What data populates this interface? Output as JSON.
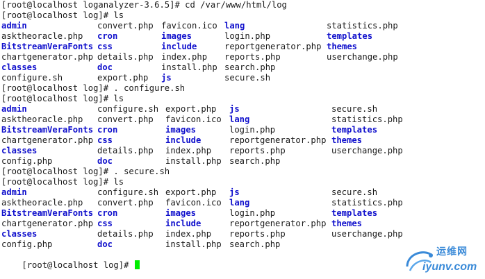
{
  "terminal": {
    "lines": {
      "l1": "[root@localhost loganalyzer-3.6.5]# cd /var/www/html/log",
      "l2": "[root@localhost log]# ls",
      "l9": "[root@localhost log]# . configure.sh",
      "l10": "[root@localhost log]# ls",
      "l17": "[root@localhost log]# . secure.sh",
      "l18": "[root@localhost log]# ls",
      "l25": "[root@localhost log]# "
    },
    "ls1": [
      [
        "admin",
        "convert.php",
        "favicon.ico",
        "lang",
        "statistics.php"
      ],
      [
        "asktheoracle.php",
        "cron",
        "images",
        "login.php",
        "templates"
      ],
      [
        "BitstreamVeraFonts",
        "css",
        "include",
        "reportgenerator.php",
        "themes"
      ],
      [
        "chartgenerator.php",
        "details.php",
        "index.php",
        "reports.php",
        "userchange.php"
      ],
      [
        "classes",
        "doc",
        "install.php",
        "search.php",
        ""
      ],
      [
        "configure.sh",
        "export.php",
        "js",
        "secure.sh",
        ""
      ]
    ],
    "ls2": [
      [
        "admin",
        "configure.sh",
        "export.php",
        "js",
        "secure.sh"
      ],
      [
        "asktheoracle.php",
        "convert.php",
        "favicon.ico",
        "lang",
        "statistics.php"
      ],
      [
        "BitstreamVeraFonts",
        "cron",
        "images",
        "login.php",
        "templates"
      ],
      [
        "chartgenerator.php",
        "css",
        "include",
        "reportgenerator.php",
        "themes"
      ],
      [
        "classes",
        "details.php",
        "index.php",
        "reports.php",
        "userchange.php"
      ],
      [
        "config.php",
        "doc",
        "install.php",
        "search.php",
        ""
      ]
    ],
    "ls3": [
      [
        "admin",
        "configure.sh",
        "export.php",
        "js",
        "secure.sh"
      ],
      [
        "asktheoracle.php",
        "convert.php",
        "favicon.ico",
        "lang",
        "statistics.php"
      ],
      [
        "BitstreamVeraFonts",
        "cron",
        "images",
        "login.php",
        "templates"
      ],
      [
        "chartgenerator.php",
        "css",
        "include",
        "reportgenerator.php",
        "themes"
      ],
      [
        "classes",
        "details.php",
        "index.php",
        "reports.php",
        "userchange.php"
      ],
      [
        "config.php",
        "doc",
        "install.php",
        "search.php",
        ""
      ]
    ],
    "directories": [
      "admin",
      "cron",
      "images",
      "lang",
      "templates",
      "BitstreamVeraFonts",
      "css",
      "include",
      "themes",
      "classes",
      "doc",
      "js"
    ],
    "colors": {
      "background": "#ffffff",
      "text": "#1a1a1a",
      "directory": "#1010cc",
      "cursor": "#00ee00"
    }
  },
  "watermark": {
    "cn_text": "运维网",
    "en_text": "iyunv.com",
    "color": "#3a8ad8"
  }
}
